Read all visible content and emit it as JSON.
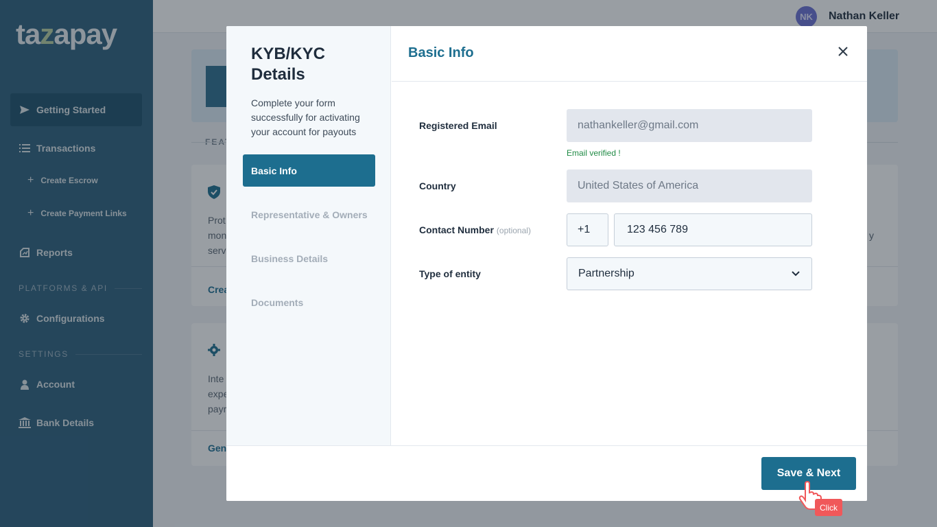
{
  "app": {
    "logo_text_a": "ta",
    "logo_text_z": "z",
    "logo_text_b": "apay"
  },
  "sidebar": {
    "items": [
      {
        "label": "Getting Started",
        "icon": "send-icon"
      },
      {
        "label": "Transactions",
        "icon": "list-icon"
      },
      {
        "label": "Create Escrow",
        "icon": "plus-icon"
      },
      {
        "label": "Create Payment Links",
        "icon": "plus-icon"
      },
      {
        "label": "Reports",
        "icon": "reports-icon"
      },
      {
        "label": "Configurations",
        "icon": "gear-icon"
      },
      {
        "label": "Account",
        "icon": "user-icon"
      },
      {
        "label": "Bank Details",
        "icon": "bank-icon"
      }
    ],
    "sections": {
      "platforms": "PLATFORMS & API",
      "settings": "SETTINGS"
    }
  },
  "topbar": {
    "avatar_initials": "NK",
    "user_name": "Nathan Keller"
  },
  "background": {
    "feat_label": "FEAT",
    "card1_text": [
      "Prot",
      "mon",
      "serv"
    ],
    "card1_link": "Crea",
    "card1_right": "y",
    "card2_text": [
      "Inte",
      "expe",
      "payr"
    ],
    "card2_link": "Gene"
  },
  "modal": {
    "title": "KYB/KYC Details",
    "description": "Complete your form successfully for activating your account for payouts",
    "steps": [
      "Basic Info",
      "Representative & Owners",
      "Business Details",
      "Documents"
    ],
    "header_title": "Basic Info",
    "fields": {
      "email_label": "Registered Email",
      "email_value": "nathankeller@gmail.com",
      "email_status": "Email verified !",
      "country_label": "Country",
      "country_value": "United States of America",
      "contact_label": "Contact Number",
      "contact_optional": "(optional)",
      "dial_code": "+1",
      "phone_value": "123 456 789",
      "entity_label": "Type of entity",
      "entity_value": "Partnership"
    },
    "save_label": "Save & Next"
  },
  "cursor": {
    "click_label": "Click"
  },
  "colors": {
    "primary": "#1d6e8f",
    "sidebar": "#2c5f7c",
    "verified": "#1f8a44",
    "click_tag": "#f0585a"
  }
}
